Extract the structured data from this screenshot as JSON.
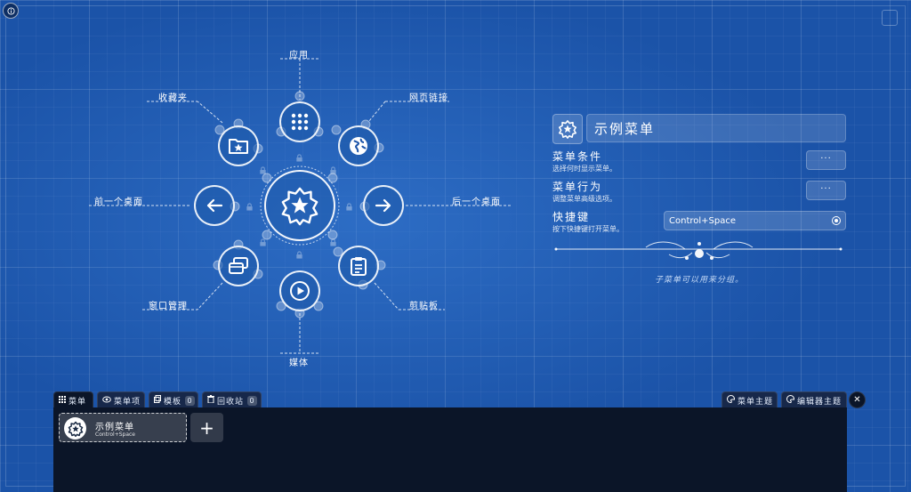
{
  "radial_menu": {
    "center_icon": "badge-star-icon",
    "items": [
      {
        "label": "应用",
        "icon": "grid-icon"
      },
      {
        "label": "网页链接",
        "icon": "globe-icon"
      },
      {
        "label": "后一个桌面",
        "icon": "arrow-right-icon"
      },
      {
        "label": "剪贴板",
        "icon": "clipboard-icon"
      },
      {
        "label": "媒体",
        "icon": "play-icon"
      },
      {
        "label": "窗口管理",
        "icon": "windows-icon"
      },
      {
        "label": "前一个桌面",
        "icon": "arrow-left-icon"
      },
      {
        "label": "收藏夹",
        "icon": "folder-star-icon"
      }
    ]
  },
  "properties": {
    "menu_name": "示例菜单",
    "conditions": {
      "title": "菜单条件",
      "subtitle": "选择何时显示菜单。",
      "button": "···"
    },
    "behavior": {
      "title": "菜单行为",
      "subtitle": "调整菜单高级选项。",
      "button": "···"
    },
    "shortcut": {
      "title": "快捷键",
      "subtitle": "按下快捷键打开菜单。",
      "value": "Control+Space"
    },
    "hint": "子菜单可以用来分组。"
  },
  "tabs": {
    "menus": "菜单",
    "menu_items": "菜单项",
    "templates": "模板",
    "templates_count": "0",
    "trash": "回收站",
    "trash_count": "0",
    "menu_themes": "菜单主题",
    "editor_themes": "编辑器主题",
    "close": "✕"
  },
  "menu_list": {
    "items": [
      {
        "title": "示例菜单",
        "shortcut": "Control+Space"
      }
    ],
    "add": "+"
  },
  "colors": {
    "background": "#1b53a8",
    "drawer": "#0b1528",
    "tab": "#17284a"
  }
}
